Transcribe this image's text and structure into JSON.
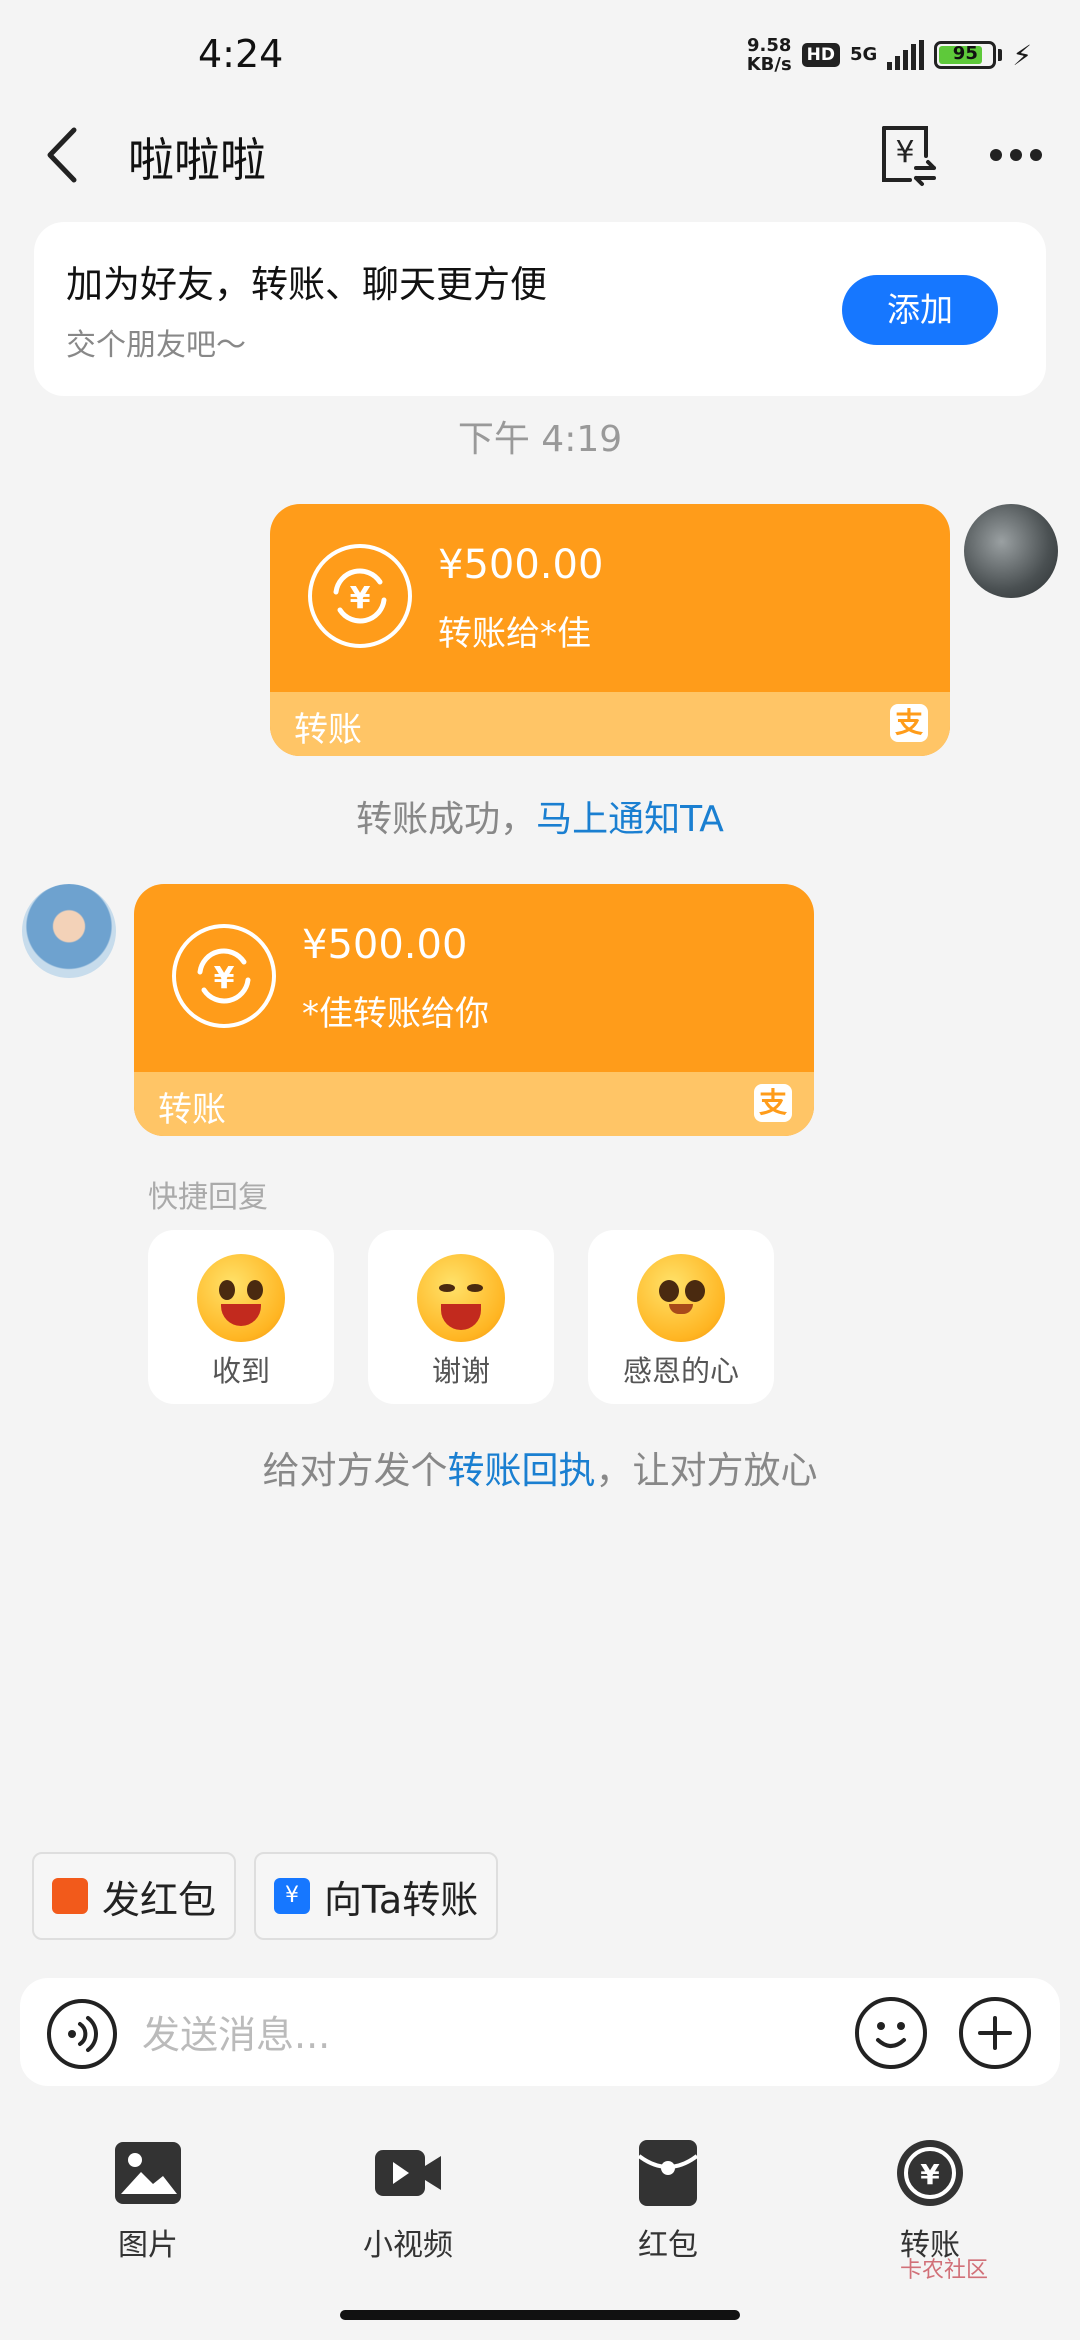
{
  "status_bar": {
    "time": "4:24",
    "net_speed_value": "9.58",
    "net_speed_unit": "KB/s",
    "hd": "HD",
    "network": "5G",
    "battery": "95"
  },
  "header": {
    "title": "啦啦啦"
  },
  "friend_card": {
    "title": "加为好友，转账、聊天更方便",
    "subtitle": "交个朋友吧～",
    "add_label": "添加"
  },
  "timestamp": "下午 4:19",
  "messages": [
    {
      "amount": "¥500.00",
      "desc": "转账给*佳",
      "label": "转账"
    },
    {
      "amount": "¥500.00",
      "desc": "*佳转账给你",
      "label": "转账"
    }
  ],
  "system_notice": {
    "text": "转账成功，",
    "link": "马上通知TA"
  },
  "quick_reply": {
    "title": "快捷回复",
    "items": [
      "收到",
      "谢谢",
      "感恩的心"
    ]
  },
  "receipt_tip": {
    "prefix": "给对方发个",
    "link": "转账回执",
    "suffix": "，让对方放心"
  },
  "shortcuts": {
    "red_packet": "发红包",
    "transfer": "向Ta转账"
  },
  "input": {
    "placeholder": "发送消息..."
  },
  "toolbar": {
    "items": [
      "图片",
      "小视频",
      "红包",
      "转账"
    ]
  },
  "watermark": "卡农社区",
  "colors": {
    "accent_blue": "#1677ff",
    "transfer_orange": "#ff9c1a",
    "link_blue": "#1a7fd1"
  }
}
